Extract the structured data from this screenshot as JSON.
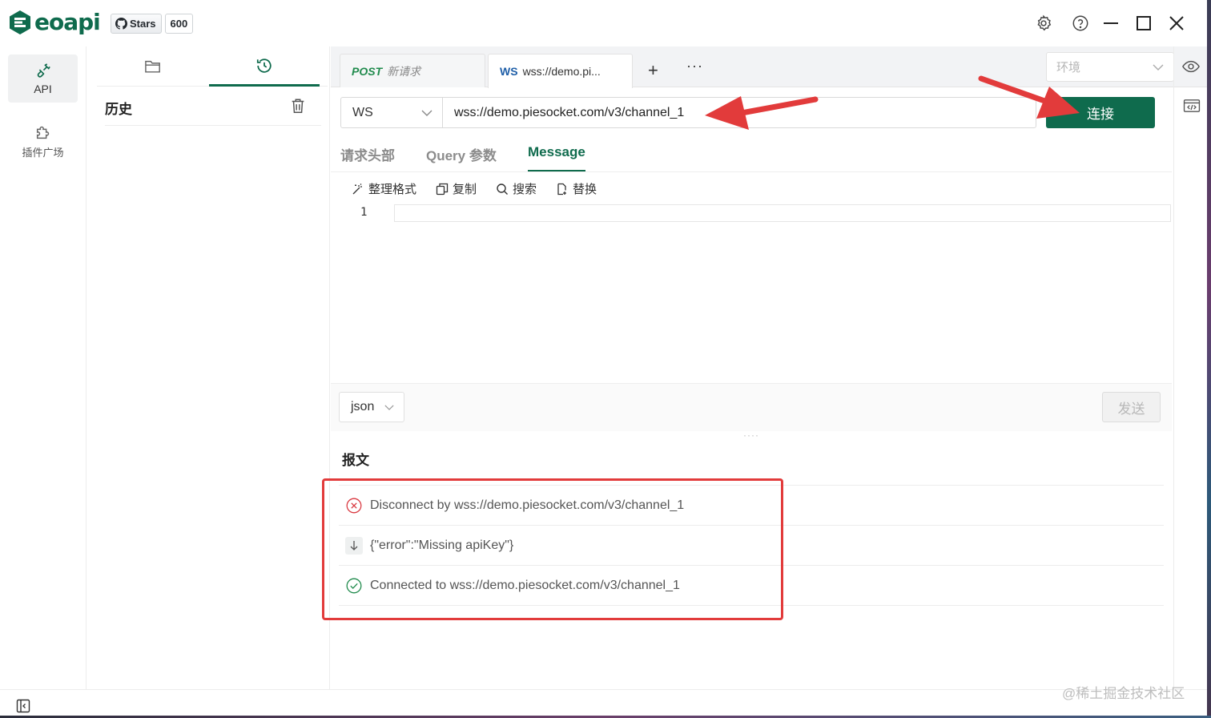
{
  "app": {
    "logo_text": "eoapi",
    "github": {
      "stars_label": "Stars",
      "stars_count": "600"
    }
  },
  "titlebar_icons": [
    "gear-icon",
    "help-icon",
    "minimize-icon",
    "maximize-icon",
    "close-icon"
  ],
  "leftnav": {
    "items": [
      {
        "label": "API",
        "icon": "plug-icon",
        "active": true
      },
      {
        "label": "插件广场",
        "icon": "puzzle-icon",
        "active": false
      }
    ]
  },
  "sidebar": {
    "tabs": [
      {
        "icon": "folder-icon",
        "active": false
      },
      {
        "icon": "history-icon",
        "active": true
      }
    ],
    "title": "历史"
  },
  "tabs": [
    {
      "method": "POST",
      "title": "新请求",
      "active": false
    },
    {
      "method": "WS",
      "title": "wss://demo.pi...",
      "active": true
    }
  ],
  "tabs_actions": {
    "add": "+",
    "more": "···"
  },
  "environment": {
    "placeholder": "环境"
  },
  "request": {
    "protocol": "WS",
    "url": "wss://demo.piesocket.com/v3/channel_1",
    "connect_label": "连接"
  },
  "subtabs": [
    {
      "label": "请求头部",
      "active": false
    },
    {
      "label": "Query 参数",
      "active": false
    },
    {
      "label": "Message",
      "active": true
    }
  ],
  "editor": {
    "tools": [
      {
        "label": "整理格式",
        "icon": "magic-wand-icon"
      },
      {
        "label": "复制",
        "icon": "copy-icon"
      },
      {
        "label": "搜索",
        "icon": "search-icon"
      },
      {
        "label": "替换",
        "icon": "replace-icon"
      }
    ],
    "line_number": "1"
  },
  "message": {
    "format": "json",
    "send_label": "发送"
  },
  "log": {
    "title": "报文",
    "entries": [
      {
        "type": "disconnect",
        "icon": "error-circle-icon",
        "text": "Disconnect by wss://demo.piesocket.com/v3/channel_1"
      },
      {
        "type": "received",
        "icon": "arrow-down-icon",
        "text": "{\"error\":\"Missing apiKey\"}"
      },
      {
        "type": "connected",
        "icon": "check-circle-icon",
        "text": "Connected to wss://demo.piesocket.com/v3/channel_1"
      }
    ]
  },
  "watermark": "@稀土掘金技术社区",
  "colors": {
    "brand": "#0f6b4d",
    "annotation": "#e23b3b",
    "error": "#d9363e",
    "success": "#1f8a4c"
  }
}
